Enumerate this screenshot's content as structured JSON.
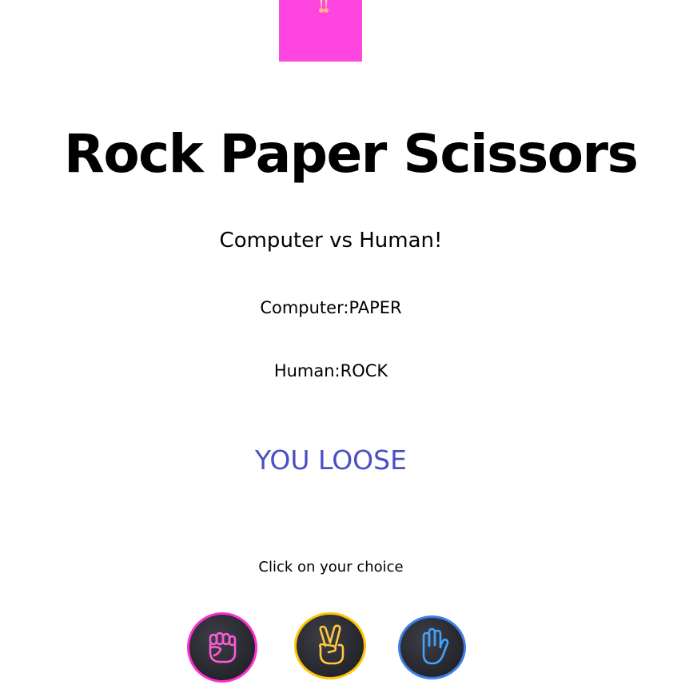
{
  "header": {
    "title": "Rock Paper Scissors",
    "subtitle": "Computer vs Human!"
  },
  "game": {
    "computer_label": "Computer:",
    "computer_choice": "PAPER",
    "human_label": "Human:",
    "human_choice": "ROCK",
    "result": "YOU LOOSE"
  },
  "choices": {
    "instruction": "Click on your choice",
    "items": [
      {
        "name": "rock",
        "icon": "fist-icon",
        "color": "#ff2fd0"
      },
      {
        "name": "scissors",
        "icon": "peace-hand-icon",
        "color": "#ffc400"
      },
      {
        "name": "paper",
        "icon": "open-hand-icon",
        "color": "#3f7fe8"
      }
    ]
  },
  "colors": {
    "result": "#4b4fc4",
    "banner": "#ff45e0"
  }
}
